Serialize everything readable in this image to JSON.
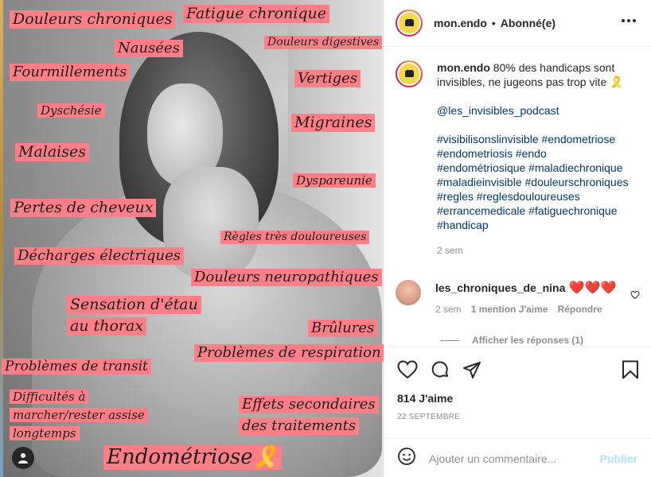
{
  "photo": {
    "tags": [
      "Douleurs chroniques",
      "Fatigue chronique",
      "Nausées",
      "Douleurs digestives",
      "Fourmillements",
      "Vertiges",
      "Dyschésie",
      "Migraines",
      "Malaises",
      "Dyspareunie",
      "Pertes de cheveux",
      "Règles très douloureuses",
      "Décharges électriques",
      "Douleurs neuropathiques",
      "Sensation d'étau",
      "au thorax",
      "Brûlures",
      "Problèmes de respiration",
      "Problèmes de transit",
      "Difficultés à",
      "marcher/rester assise",
      "longtemps",
      "Effets secondaires",
      "des traitements",
      "Endométriose🎗️"
    ],
    "tag_color": "#ff7f86"
  },
  "header": {
    "username": "mon.endo",
    "separator": "•",
    "follow_status": "Abonné(e)"
  },
  "caption": {
    "username": "mon.endo",
    "text": "80% des handicaps sont invisibles, ne jugeons pas trop vite 🎗️",
    "mention": "@les_invisibles_podcast",
    "hashtag_lines": [
      "#visibilisonslinvisible #endometriose",
      "#endometriosis #endo",
      "#endométriosique #maladiechronique",
      "#maladieinvisible #douleurschroniques",
      "#regles #reglesdouloureuses",
      "#errancemedicale #fatiguechronique",
      "#handicap"
    ],
    "time": "2 sem"
  },
  "comment": {
    "username": "les_chroniques_de_nina",
    "text": "❤️❤️❤️",
    "time": "2 sem",
    "likes": "1 mention J'aime",
    "reply": "Répondre"
  },
  "replies": {
    "label": "Afficher les réponses (1)"
  },
  "footer": {
    "likes": "814 J'aime",
    "date": "22 SEPTEMBRE",
    "comment_placeholder": "Ajouter un commentaire...",
    "publish": "Publier"
  },
  "colors": {
    "link": "#00376b",
    "muted": "#8e8e8e",
    "publish_disabled": "#b2dffc"
  },
  "icons": [
    "user-tag-icon",
    "more-options-icon",
    "heart-icon",
    "comment-icon",
    "share-icon",
    "bookmark-icon",
    "emoji-icon",
    "like-comment-icon"
  ]
}
